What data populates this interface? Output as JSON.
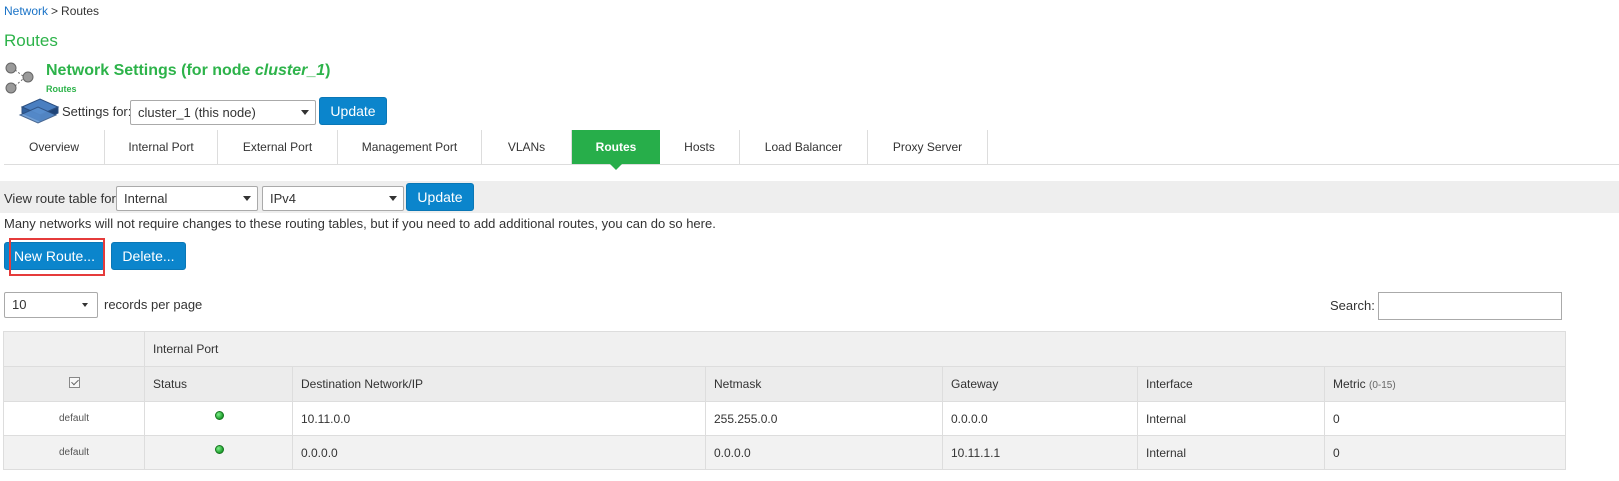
{
  "breadcrumb": {
    "parent": "Network",
    "separator": ">",
    "current": "Routes"
  },
  "page_title": "Routes",
  "header": {
    "title_prefix": "Network Settings (for node ",
    "node_name": "cluster_1",
    "title_suffix": ")",
    "subtitle": "Routes",
    "settings_for_label": "Settings for:",
    "settings_for_value": "cluster_1 (this node)",
    "update_label": "Update"
  },
  "tabs": [
    {
      "label": "Overview",
      "active": false
    },
    {
      "label": "Internal Port",
      "active": false
    },
    {
      "label": "External Port",
      "active": false
    },
    {
      "label": "Management Port",
      "active": false
    },
    {
      "label": "VLANs",
      "active": false
    },
    {
      "label": "Routes",
      "active": true
    },
    {
      "label": "Hosts",
      "active": false
    },
    {
      "label": "Load Balancer",
      "active": false
    },
    {
      "label": "Proxy Server",
      "active": false
    }
  ],
  "route_table": {
    "label": "View route table for:",
    "table_select": "Internal",
    "ip_select": "IPv4",
    "update_label": "Update"
  },
  "intro_text": "Many networks will not require changes to these routing tables, but if you need to add additional routes, you can do so here.",
  "actions": {
    "new_route": "New Route...",
    "delete": "Delete..."
  },
  "pagination": {
    "page_size": "10",
    "records_label": "records per page"
  },
  "search": {
    "label": "Search:",
    "value": ""
  },
  "table": {
    "group_header": "Internal Port",
    "columns": {
      "status": "Status",
      "destination": "Destination Network/IP",
      "netmask": "Netmask",
      "gateway": "Gateway",
      "interface": "Interface",
      "metric": "Metric",
      "metric_range": "(0-15)"
    },
    "rows": [
      {
        "type": "default",
        "destination": "10.11.0.0",
        "netmask": "255.255.0.0",
        "gateway": "0.0.0.0",
        "interface": "Internal",
        "metric": "0"
      },
      {
        "type": "default",
        "destination": "0.0.0.0",
        "netmask": "0.0.0.0",
        "gateway": "10.11.1.1",
        "interface": "Internal",
        "metric": "0"
      }
    ]
  },
  "colors": {
    "accent_green": "#2db34a",
    "button_blue": "#0b85cc",
    "highlight_red": "#e53b3b",
    "link_blue": "#1a73c7"
  },
  "icons": {
    "node": "cluster-node-icon",
    "network": "network-device-icon",
    "status": "status-green-dot-icon",
    "select_all": "checkbox-icon"
  }
}
